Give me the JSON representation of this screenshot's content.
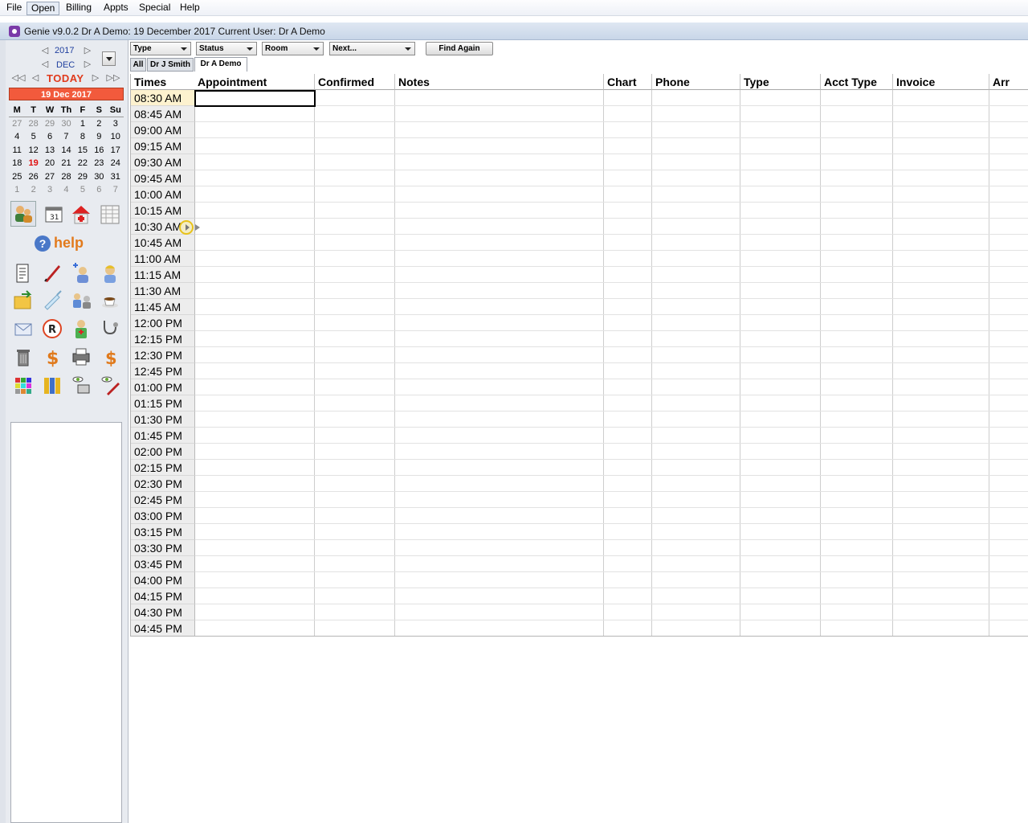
{
  "menubar": {
    "items": [
      "File",
      "Open",
      "Billing",
      "Appts",
      "Special",
      "Help"
    ]
  },
  "titlebar": {
    "text": "Genie v9.0.2   Dr A Demo: 19 December 2017   Current User: Dr A Demo"
  },
  "calendar": {
    "year": "2017",
    "month": "DEC",
    "today_label": "TODAY",
    "selected_date_label": "19 Dec 2017",
    "weekdays": [
      "M",
      "T",
      "W",
      "Th",
      "F",
      "S",
      "Su"
    ],
    "weeks": [
      [
        "27",
        "28",
        "29",
        "30",
        "1",
        "2",
        "3"
      ],
      [
        "4",
        "5",
        "6",
        "7",
        "8",
        "9",
        "10"
      ],
      [
        "11",
        "12",
        "13",
        "14",
        "15",
        "16",
        "17"
      ],
      [
        "18",
        "19",
        "20",
        "21",
        "22",
        "23",
        "24"
      ],
      [
        "25",
        "26",
        "27",
        "28",
        "29",
        "30",
        "31"
      ],
      [
        "1",
        "2",
        "3",
        "4",
        "5",
        "6",
        "7"
      ]
    ],
    "selected_day": "19"
  },
  "help_label": "help",
  "filters": {
    "type": "Type",
    "status": "Status",
    "room": "Room",
    "next": "Next...",
    "find_again": "Find Again"
  },
  "tabs": [
    "All",
    "Dr J Smith",
    "Dr A Demo"
  ],
  "active_tab": "Dr A Demo",
  "columns": [
    "Times",
    "Appointment",
    "Confirmed",
    "Notes",
    "Chart",
    "Phone",
    "Type",
    "Acct Type",
    "Invoice",
    "Arr"
  ],
  "times": [
    "08:30 AM",
    "08:45 AM",
    "09:00 AM",
    "09:15 AM",
    "09:30 AM",
    "09:45 AM",
    "10:00 AM",
    "10:15 AM",
    "10:30 AM",
    "10:45 AM",
    "11:00 AM",
    "11:15 AM",
    "11:30 AM",
    "11:45 AM",
    "12:00 PM",
    "12:15 PM",
    "12:30 PM",
    "12:45 PM",
    "01:00 PM",
    "01:15 PM",
    "01:30 PM",
    "01:45 PM",
    "02:00 PM",
    "02:15 PM",
    "02:30 PM",
    "02:45 PM",
    "03:00 PM",
    "03:15 PM",
    "03:30 PM",
    "03:45 PM",
    "04:00 PM",
    "04:15 PM",
    "04:30 PM",
    "04:45 PM"
  ],
  "current_time_row": "08:30 AM",
  "colors": {
    "accent_red": "#e03a1c",
    "date_box": "#f25a3c",
    "link_blue": "#1f3f9e",
    "help_orange": "#e27a1c"
  }
}
